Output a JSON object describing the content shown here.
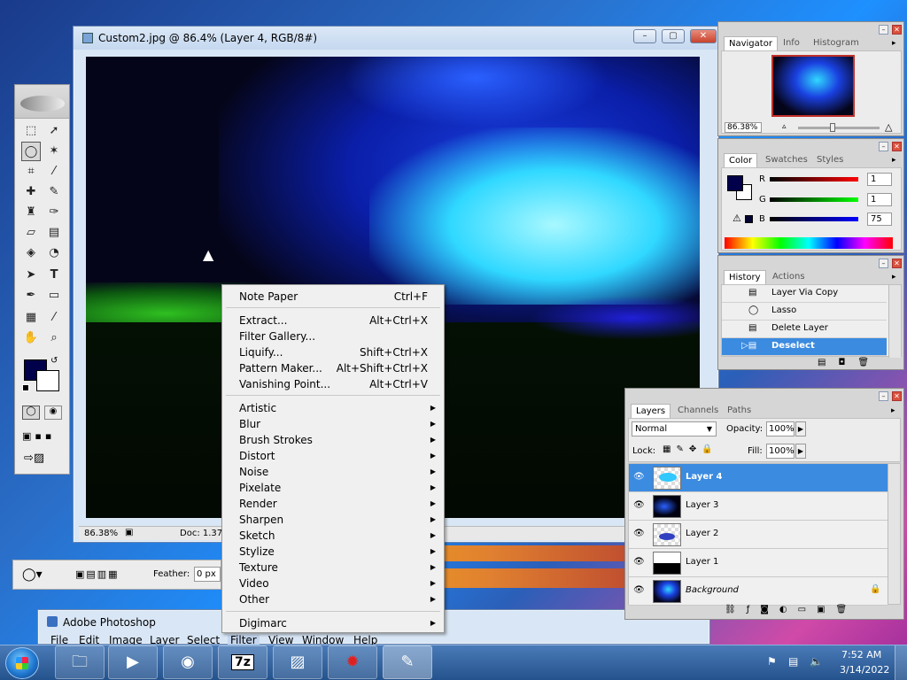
{
  "image_window": {
    "title": "Custom2.jpg @ 86.4% (Layer 4, RGB/8#)",
    "zoom_status": "86.38%",
    "doc_status": "Doc: 1.37M"
  },
  "filter_menu": {
    "items_top": [
      {
        "label": "Note Paper",
        "shortcut": "Ctrl+F"
      }
    ],
    "items_mid": [
      {
        "label": "Extract...",
        "shortcut": "Alt+Ctrl+X"
      },
      {
        "label": "Filter Gallery...",
        "shortcut": ""
      },
      {
        "label": "Liquify...",
        "shortcut": "Shift+Ctrl+X"
      },
      {
        "label": "Pattern Maker...",
        "shortcut": "Alt+Shift+Ctrl+X"
      },
      {
        "label": "Vanishing Point...",
        "shortcut": "Alt+Ctrl+V"
      }
    ],
    "submenus": [
      "Artistic",
      "Blur",
      "Brush Strokes",
      "Distort",
      "Noise",
      "Pixelate",
      "Render",
      "Sharpen",
      "Sketch",
      "Stylize",
      "Texture",
      "Video",
      "Other"
    ],
    "bottom": "Digimarc"
  },
  "navigator": {
    "tabs": [
      "Navigator",
      "Info",
      "Histogram"
    ],
    "zoom": "86.38%"
  },
  "color_panel": {
    "tabs": [
      "Color",
      "Swatches",
      "Styles"
    ],
    "r_label": "R",
    "g_label": "G",
    "b_label": "B",
    "r": "1",
    "g": "1",
    "b": "75"
  },
  "history_panel": {
    "tabs": [
      "History",
      "Actions"
    ],
    "items": [
      "Layer Via Copy",
      "Lasso",
      "Delete Layer",
      "Deselect"
    ]
  },
  "layers_panel": {
    "tabs": [
      "Layers",
      "Channels",
      "Paths"
    ],
    "blend_mode": "Normal",
    "opacity_label": "Opacity:",
    "opacity": "100%",
    "lock_label": "Lock:",
    "fill_label": "Fill:",
    "fill": "100%",
    "layers": [
      "Layer 4",
      "Layer 3",
      "Layer 2",
      "Layer 1",
      "Background"
    ]
  },
  "options_bar": {
    "feather_label": "Feather:",
    "feather_value": "0 px"
  },
  "app_window": {
    "title": "Adobe Photoshop",
    "menu": [
      "File",
      "Edit",
      "Image",
      "Layer",
      "Select",
      "Filter",
      "View",
      "Window",
      "Help"
    ]
  },
  "taskbar": {
    "time": "7:52 AM",
    "date": "3/14/2022",
    "apps": [
      "7z"
    ]
  },
  "colors": {
    "selection": "#3b8be0",
    "foreground_swatch": "#01014b"
  }
}
